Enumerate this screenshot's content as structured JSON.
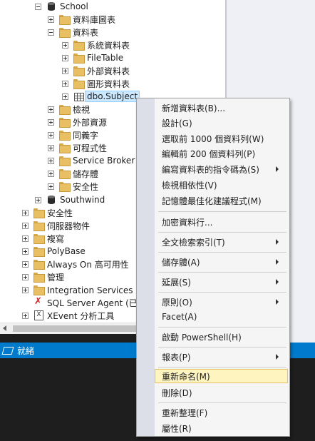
{
  "tree": {
    "nodes": [
      {
        "label": "School",
        "icon": "database-icon",
        "expander": "minus"
      },
      {
        "label": "資料庫圖表",
        "icon": "folder-icon",
        "expander": "plus"
      },
      {
        "label": "資料表",
        "icon": "folder-icon",
        "expander": "minus"
      },
      {
        "label": "系統資料表",
        "icon": "folder-icon",
        "expander": "plus"
      },
      {
        "label": "FileTable",
        "icon": "folder-icon",
        "expander": "plus"
      },
      {
        "label": "外部資料表",
        "icon": "folder-icon",
        "expander": "plus"
      },
      {
        "label": "圖形資料表",
        "icon": "folder-icon",
        "expander": "plus"
      },
      {
        "label": "dbo.Subject",
        "icon": "table-icon",
        "expander": "plus",
        "selected": true
      },
      {
        "label": "檢視",
        "icon": "folder-icon",
        "expander": "plus"
      },
      {
        "label": "外部資源",
        "icon": "folder-icon",
        "expander": "plus"
      },
      {
        "label": "同義字",
        "icon": "folder-icon",
        "expander": "plus"
      },
      {
        "label": "可程式性",
        "icon": "folder-icon",
        "expander": "plus"
      },
      {
        "label": "Service Broker",
        "icon": "folder-icon",
        "expander": "plus"
      },
      {
        "label": "儲存體",
        "icon": "folder-icon",
        "expander": "plus"
      },
      {
        "label": "安全性",
        "icon": "folder-icon",
        "expander": "plus"
      },
      {
        "label": "Southwind",
        "icon": "database-icon",
        "expander": "plus"
      },
      {
        "label": "安全性",
        "icon": "folder-icon",
        "expander": "plus"
      },
      {
        "label": "伺服器物件",
        "icon": "folder-icon",
        "expander": "plus"
      },
      {
        "label": "複寫",
        "icon": "folder-icon",
        "expander": "plus"
      },
      {
        "label": "PolyBase",
        "icon": "folder-icon",
        "expander": "plus"
      },
      {
        "label": "Always On 高可用性",
        "icon": "folder-icon",
        "expander": "plus"
      },
      {
        "label": "管理",
        "icon": "folder-icon",
        "expander": "plus"
      },
      {
        "label": "Integration Services 目",
        "icon": "folder-icon",
        "expander": "plus"
      },
      {
        "label": "SQL Server Agent (已停",
        "icon": "agent-icon",
        "expander": "none"
      },
      {
        "label": "XEvent 分析工具",
        "icon": "xevent-icon",
        "expander": "plus"
      }
    ]
  },
  "status": {
    "text": "就緒"
  },
  "context_menu": {
    "items": [
      {
        "label": "新增資料表(B)...",
        "submenu": false
      },
      {
        "label": "設計(G)",
        "submenu": false
      },
      {
        "label": "選取前 1000 個資料列(W)",
        "submenu": false
      },
      {
        "label": "編輯前 200 個資料列(P)",
        "submenu": false
      },
      {
        "label": "編寫資料表的指令碼為(S)",
        "submenu": true
      },
      {
        "label": "檢視相依性(V)",
        "submenu": false
      },
      {
        "label": "記憶體最佳化建議程式(M)",
        "submenu": false
      },
      {
        "label": "加密資料行...",
        "submenu": false
      },
      {
        "label": "全文檢索索引(T)",
        "submenu": true
      },
      {
        "label": "儲存體(A)",
        "submenu": true
      },
      {
        "label": "延展(S)",
        "submenu": true
      },
      {
        "label": "原則(O)",
        "submenu": true
      },
      {
        "label": "Facet(A)",
        "submenu": false
      },
      {
        "label": "啟動 PowerShell(H)",
        "submenu": false
      },
      {
        "label": "報表(P)",
        "submenu": true
      },
      {
        "label": "重新命名(M)",
        "submenu": false,
        "highlighted": true
      },
      {
        "label": "刪除(D)",
        "submenu": false
      },
      {
        "label": "重新整理(F)",
        "submenu": false
      },
      {
        "label": "屬性(R)",
        "submenu": false
      }
    ]
  }
}
